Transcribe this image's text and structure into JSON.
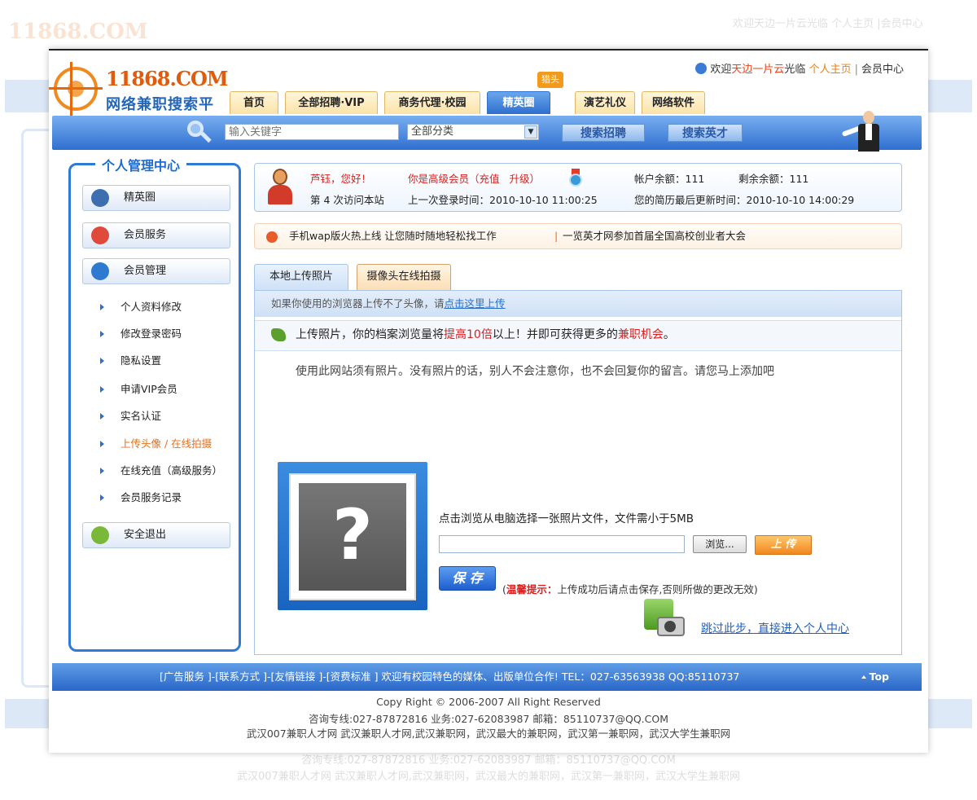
{
  "ghost": {
    "logo": "11868.COM",
    "welcome": "欢迎天边一片云光临  个人主页  |会员中心",
    "footer_line1": "咨询专线:027-87872816    业务:027-62083987 邮箱：85110737@QQ.COM",
    "footer_line2": "武汉007兼职人才网 武汉兼职人才网,武汉兼职网，武汉最大的兼职网，武汉第一兼职网，武汉大学生兼职网"
  },
  "header": {
    "brand": "11868.COM",
    "slogan": "网络兼职搜索平台",
    "welcome_prefix": "欢迎",
    "username": "天边一片云",
    "welcome_suffix": "光临",
    "home_link": "个人主页",
    "member_center": "会员中心"
  },
  "nav": {
    "tabs": [
      "首页",
      "全部招聘·VIP",
      "商务代理·校园",
      "精英圈",
      "演艺礼仪",
      "网络软件"
    ],
    "active": "精英圈",
    "badge": "猎头"
  },
  "search": {
    "placeholder": "输入关键字",
    "category": "全部分类",
    "search_jobs": "搜索招聘",
    "search_talent": "搜索英才"
  },
  "sidebar": {
    "title": "个人管理中心",
    "buttons": [
      "精英圈",
      "会员服务",
      "会员管理"
    ],
    "items": [
      "个人资料修改",
      "修改登录密码",
      "隐私设置",
      "申请VIP会员",
      "实名认证",
      "上传头像 / 在线拍摄",
      "在线充值（高级服务）",
      "会员服务记录"
    ],
    "active_item": "上传头像 / 在线拍摄",
    "logout": "安全退出"
  },
  "info": {
    "greeting": "芦钰，您好！",
    "member_level": "你是高级会员（",
    "recharge": "充值",
    "upgrade": "升级",
    "member_level_end": "）",
    "visits": "第  4 次访问本站",
    "last_login": "上一次登录时间：2010-10-10 11:00:25",
    "balance": "帐户余额：111",
    "remaining": "剩余余额：111",
    "resume_update": "您的简历最后更新时间：2010-10-10 14:00:29"
  },
  "news": {
    "item1": "手机wap版火热上线 让您随时随地轻松找工作",
    "item2": "一览英才网参加首届全国高校创业者大会"
  },
  "tabs": {
    "local": "本地上传照片",
    "camera": "摄像头在线拍摄"
  },
  "upload": {
    "hint_prefix": "如果你使用的浏览器上传不了头像，请",
    "hint_link": "点击这里上传",
    "banner_prefix": "上传照片，你的档案浏览量将",
    "banner_hl1": "提高10倍",
    "banner_mid": "以上！并即可获得更多的",
    "banner_hl2": "兼职机会",
    "banner_end": "。",
    "notice": "使用此网站须有照片。没有照片的话，别人不会注意你，也不会回复你的留言。请您马上添加吧",
    "choose_label": "点击浏览从电脑选择一张照片文件，文件需小于5MB",
    "browse": "浏览...",
    "upload_btn": "上 传",
    "save_btn": "保 存",
    "tip_label": "温馨提示：",
    "tip_text": "上传成功后请点击保存,否则所做的更改无效)",
    "tip_open": "(",
    "skip": "跳过此步，直接进入个人中心"
  },
  "footer": {
    "links": "[广告服务 ]-[联系方式 ]-[友情链接 ]-[资费标准 ] 欢迎有校园特色的媒体、出版单位合作!  TEL：027-63563938   QQ:85110737",
    "top": "Top",
    "copyright": "Copy Right © 2006-2007 All Right Reserved",
    "contact": "咨询专线:027-87872816    业务:027-62083987 邮箱：85110737@QQ.COM",
    "sites": "武汉007兼职人才网 武汉兼职人才网,武汉兼职网，武汉最大的兼职网，武汉第一兼职网，武汉大学生兼职网"
  }
}
